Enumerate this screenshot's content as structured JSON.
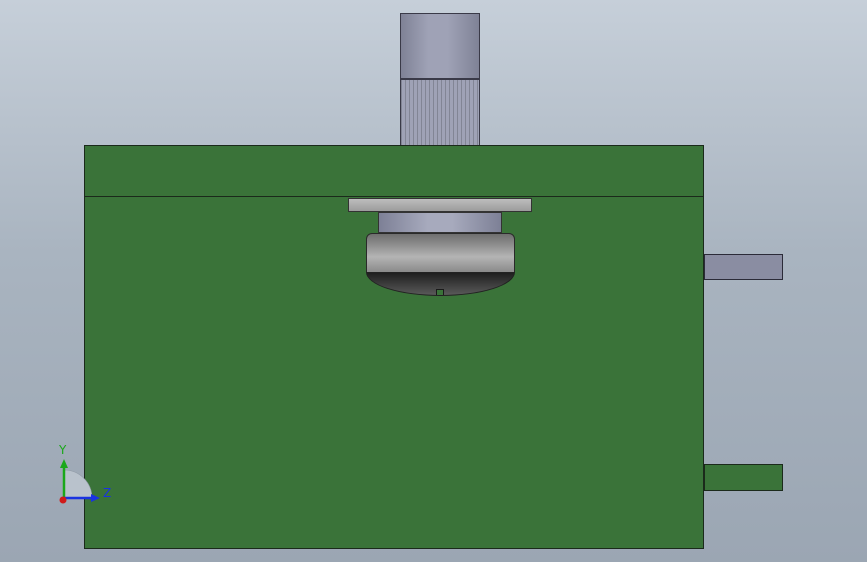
{
  "colors": {
    "housing": "#3a7339",
    "motor_light": "#9fa2b6",
    "motor_dark": "#7f8296",
    "flange": "#9c9c9c",
    "collar": "#a7aabd",
    "hub": "#8a8a8a",
    "dome": "#5a5a5a",
    "tab_upper": "#8a8da2",
    "tab_lower": "#3a7339",
    "axis_y": "#1aa81a",
    "axis_z": "#1a33e0",
    "axis_origin": "#d01a1a"
  },
  "triad": {
    "y_label": "Y",
    "z_label": "Z"
  }
}
